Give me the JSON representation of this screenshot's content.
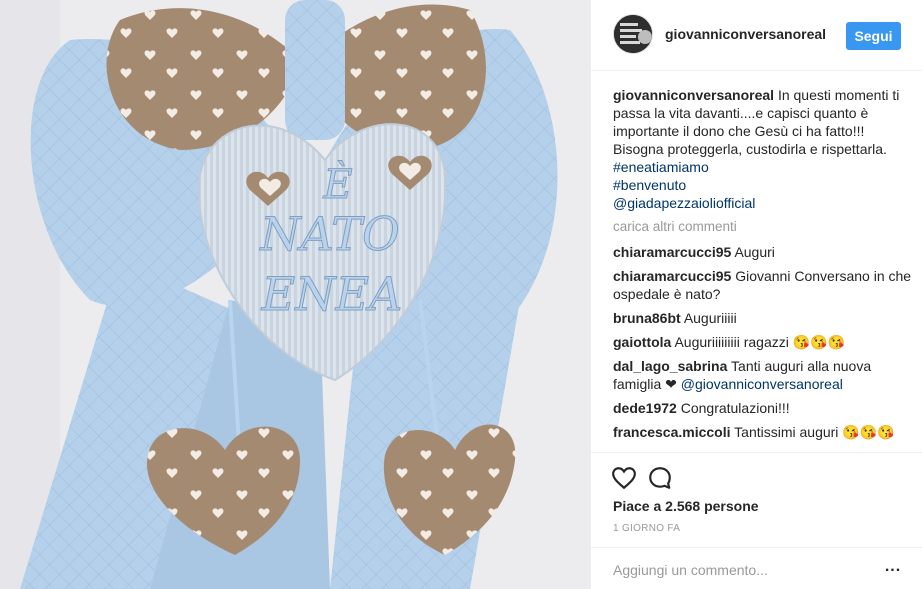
{
  "post": {
    "username": "giovanniconversanoreal",
    "follow_label": "Segui",
    "photo_text": {
      "line1": "È",
      "line2": "NATO",
      "line3": "ENEA"
    },
    "caption": {
      "username": "giovanniconversanoreal",
      "text": "In questi momenti ti passa la vita davanti....e capisci quanto è importante il dono che Gesù ci ha fatto!!! Bisogna proteggerla, custodirla e rispettarla.",
      "hashtags": [
        "#eneatiamiamo",
        "#benvenuto"
      ],
      "mention": "@giadapezzaioliofficial"
    },
    "load_more_label": "carica altri commenti",
    "comments": [
      {
        "user": "chiaramarcucci95",
        "text": "Auguri"
      },
      {
        "user": "chiaramarcucci95",
        "text": "Giovanni Conversano in che ospedale è nato?"
      },
      {
        "user": "bruna86bt",
        "text": "Auguriiiii"
      },
      {
        "user": "gaiottola",
        "text": "Auguriiiiiiiii ragazzi 😘😘😘"
      },
      {
        "user": "dal_lago_sabrina",
        "text": "Tanti auguri alla nuova famiglia ❤",
        "mention": "@giovanniconversanoreal"
      },
      {
        "user": "dede1972",
        "text": "Congratulazioni!!!"
      },
      {
        "user": "francesca.miccoli",
        "text": "Tantissimi auguri 😘😘😘"
      }
    ],
    "likes_label": "Piace a 2.568 persone",
    "date_label": "1 GIORNO FA",
    "add_comment_placeholder": "Aggiungi un commento...",
    "more_label": "...",
    "icons": {
      "like": "heart-icon",
      "comment": "comment-icon"
    },
    "colors": {
      "accent": "#3897f0",
      "link": "#003569",
      "muted": "#999999",
      "fabric_blue": "#b5d0ea",
      "fabric_brown": "#a58a72"
    }
  }
}
